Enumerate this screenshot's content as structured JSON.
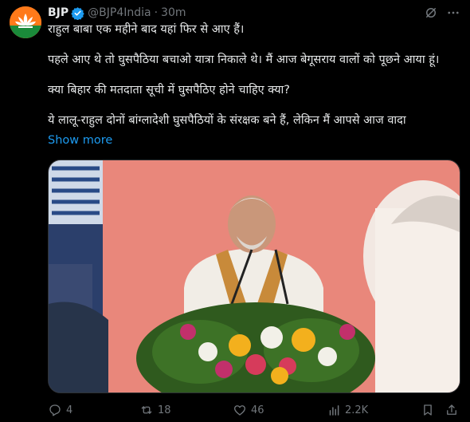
{
  "author": {
    "name": "BJP",
    "handle": "@BJP4India",
    "separator": "·",
    "time": "30m"
  },
  "tweet": {
    "lines": [
      "राहुल बाबा एक महीने बाद यहां फिर से आए हैं।",
      "पहले आए थे तो घुसपैठिया बचाओ यात्रा निकाले थे। मैं आज बेगूसराय वालों को पूछने आया हूं।",
      "क्या बिहार की मतदाता सूची में घुसपैठिए होने चाहिए क्या?",
      "ये लालू-राहुल दोनों बांग्लादेशी घुसपैठियों के संरक्षक बने हैं, लेकिन मैं आपसे आज वादा"
    ],
    "show_more": "Show more"
  },
  "actions": {
    "replies": "4",
    "reposts": "18",
    "likes": "46",
    "views": "2.2K"
  },
  "colors": {
    "accent": "#1d9bf0",
    "muted": "#71767b",
    "brand_saffron": "#ff7a1a"
  },
  "icons": [
    "verified-badge-icon",
    "grok-icon",
    "more-options-icon",
    "reply-icon",
    "repost-icon",
    "like-icon",
    "views-icon",
    "bookmark-icon",
    "share-icon"
  ]
}
